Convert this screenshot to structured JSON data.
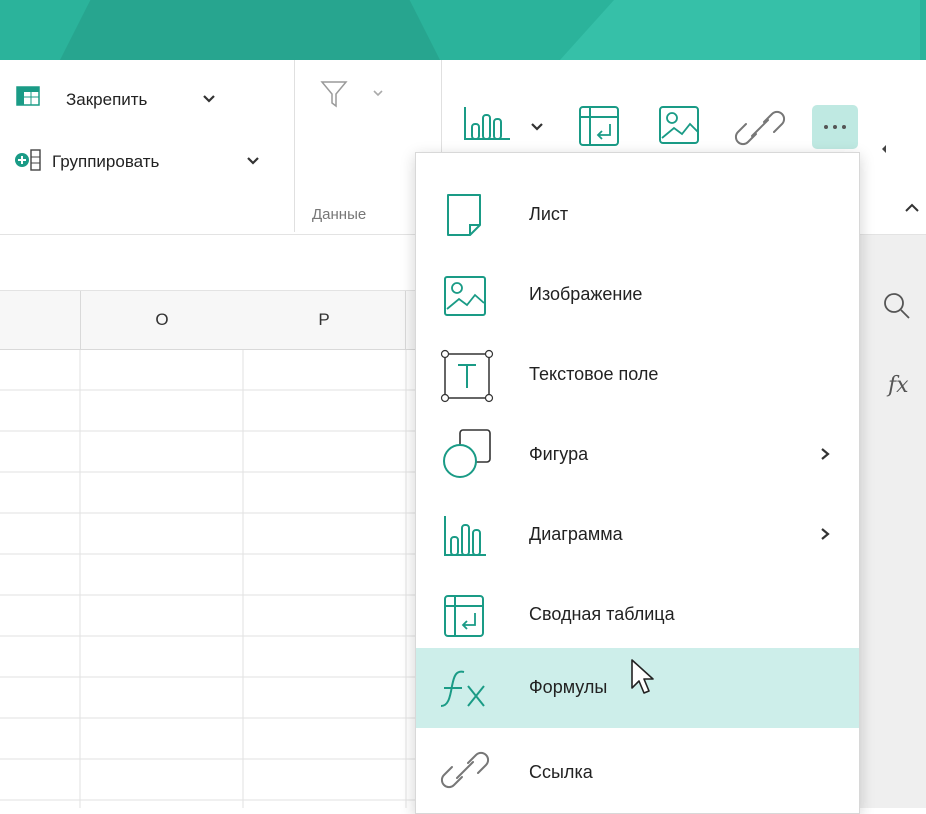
{
  "ribbon": {
    "freeze_label": "Закрепить",
    "group_label": "Группировать",
    "data_group_label": "Данные"
  },
  "columns": [
    "O",
    "P"
  ],
  "insert_menu": {
    "items": [
      {
        "label": "Лист",
        "icon": "sheet-icon",
        "submenu": false
      },
      {
        "label": "Изображение",
        "icon": "image-icon",
        "submenu": false
      },
      {
        "label": "Текстовое поле",
        "icon": "text-box-icon",
        "submenu": false
      },
      {
        "label": "Фигура",
        "icon": "shape-icon",
        "submenu": true
      },
      {
        "label": "Диаграмма",
        "icon": "chart-icon",
        "submenu": true
      },
      {
        "label": "Сводная таблица",
        "icon": "pivot-table-icon",
        "submenu": false
      },
      {
        "label": "Формулы",
        "icon": "formula-icon",
        "submenu": false,
        "selected": true
      },
      {
        "label": "Ссылка",
        "icon": "link-icon",
        "submenu": false
      }
    ]
  },
  "side_panel": {
    "formula_glyph": "fx"
  },
  "colors": {
    "accent": "#2bb39b",
    "selected_row": "#cdeeea",
    "icon_teal": "#1a9b86"
  }
}
